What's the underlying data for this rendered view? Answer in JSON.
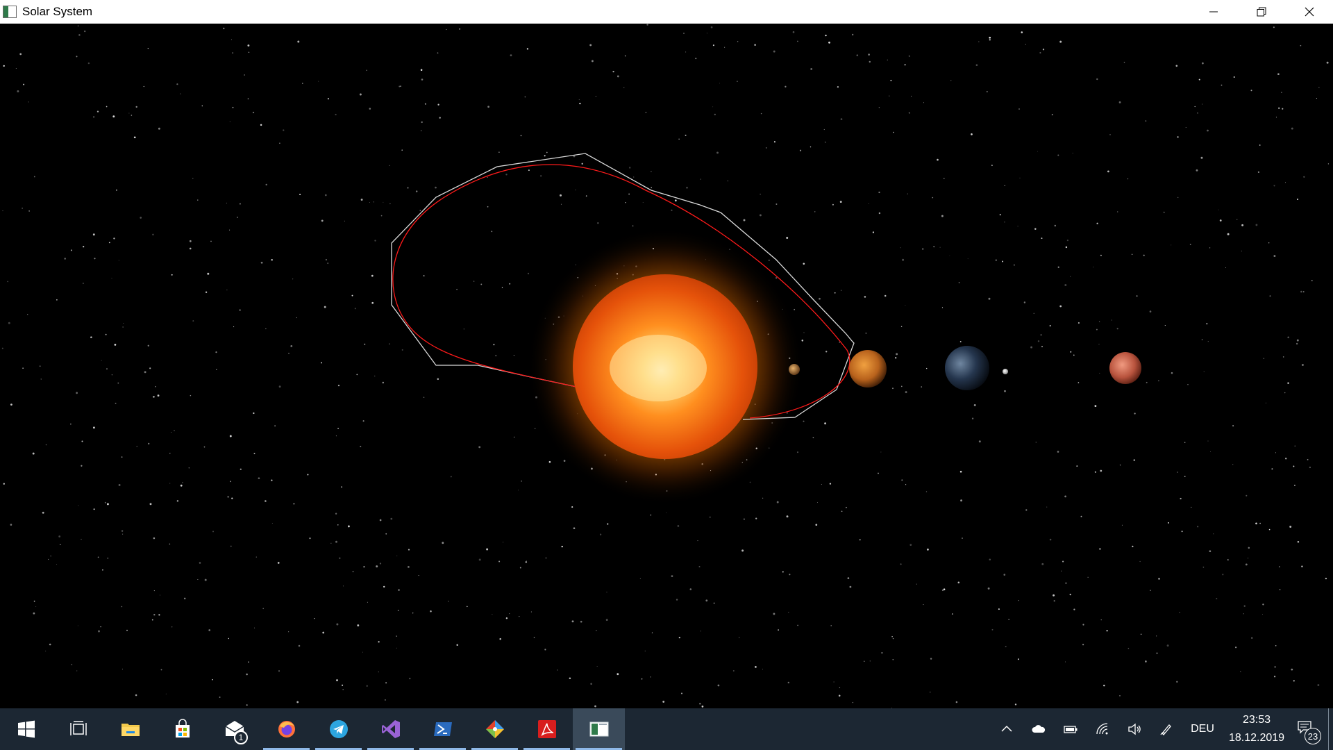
{
  "window": {
    "title": "Solar System",
    "controls": [
      "minimize-icon",
      "restore-icon",
      "close-icon"
    ]
  },
  "scene": {
    "bodies": [
      "sun",
      "mercury",
      "venus",
      "earth",
      "moon",
      "mars"
    ],
    "orbit_colors": {
      "orbit_path": "#ff1a1a",
      "hull_outline": "#d9d9d9"
    }
  },
  "taskbar": {
    "apps": [
      {
        "name": "start",
        "icon": "windows-icon"
      },
      {
        "name": "task-view",
        "icon": "task-view-icon"
      },
      {
        "name": "file-explorer",
        "icon": "folder-icon"
      },
      {
        "name": "store",
        "icon": "store-icon"
      },
      {
        "name": "mail",
        "icon": "mail-icon",
        "badge": "1"
      },
      {
        "name": "firefox",
        "icon": "firefox-icon"
      },
      {
        "name": "telegram",
        "icon": "telegram-icon"
      },
      {
        "name": "visual-studio",
        "icon": "visual-studio-icon"
      },
      {
        "name": "powershell",
        "icon": "powershell-icon"
      },
      {
        "name": "git",
        "icon": "git-icon"
      },
      {
        "name": "acrobat",
        "icon": "acrobat-icon"
      },
      {
        "name": "solar-system",
        "icon": "solar-system-app-icon"
      }
    ],
    "tray": {
      "language": "DEU",
      "time": "23:53",
      "date": "18.12.2019",
      "notifications": "23"
    }
  }
}
